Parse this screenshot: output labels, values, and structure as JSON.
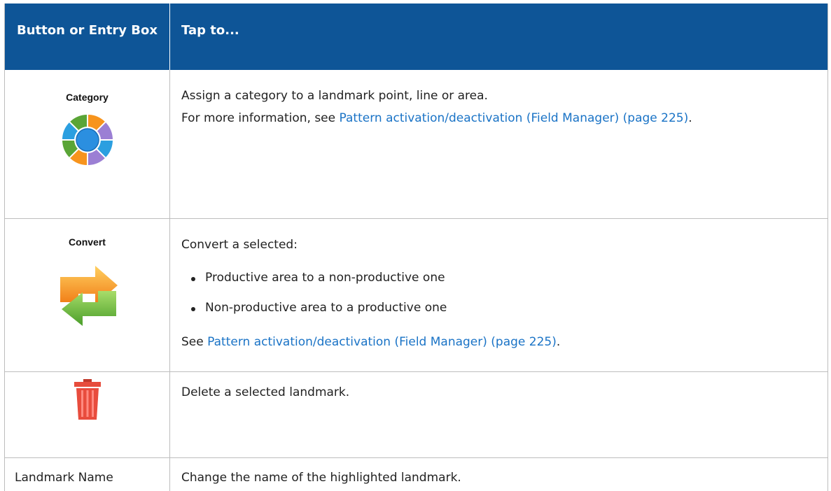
{
  "header": {
    "col1": "Button or Entry Box",
    "col2": "Tap to..."
  },
  "rows": [
    {
      "label": "Category",
      "icon": "category-wheel-icon",
      "line1": "Assign a category to a landmark point, line or area.",
      "line2_prefix": "For more information, see ",
      "link": "Pattern activation/deactivation (Field Manager) (page 225)",
      "line2_suffix": "."
    },
    {
      "label": "Convert",
      "icon": "convert-arrows-icon",
      "intro": "Convert a selected:",
      "bullets": [
        "Productive area to a non-productive one",
        "Non-productive area to a productive one"
      ],
      "see_prefix": "See ",
      "link": "Pattern activation/deactivation (Field Manager) (page 225)",
      "see_suffix": "."
    },
    {
      "label": "",
      "icon": "trash-icon",
      "text": "Delete a selected landmark."
    },
    {
      "label": "Landmark Name",
      "text": "Change the name of the highlighted landmark."
    }
  ],
  "colors": {
    "header_bg": "#0e5597",
    "link": "#1a73c6",
    "border": "#bdbdbd"
  }
}
